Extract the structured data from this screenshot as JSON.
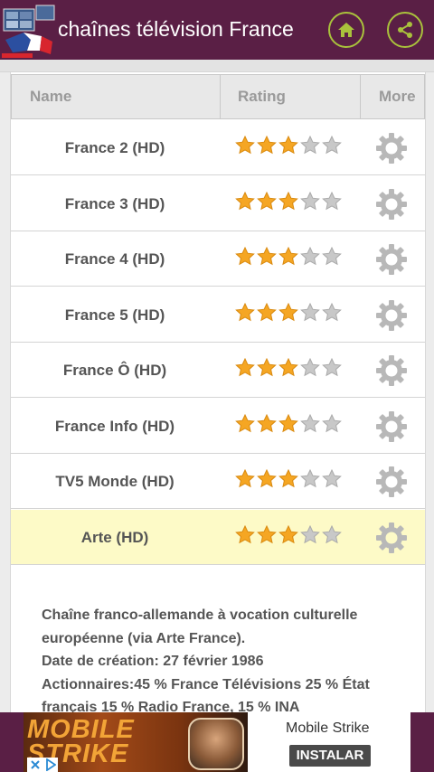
{
  "appbar": {
    "title": "chaînes télévision France",
    "logo_icon": "tv-flag-logo-icon",
    "home_icon": "home-icon",
    "share_icon": "share-icon",
    "accent_color": "#a9c13c",
    "bar_color": "#5a1f45"
  },
  "table": {
    "headers": {
      "name": "Name",
      "rating": "Rating",
      "more": "More"
    },
    "rows": [
      {
        "name": "France 2 (HD)",
        "rating": 3,
        "max_rating": 5,
        "selected": false
      },
      {
        "name": "France 3 (HD)",
        "rating": 3,
        "max_rating": 5,
        "selected": false
      },
      {
        "name": "France 4 (HD)",
        "rating": 3,
        "max_rating": 5,
        "selected": false
      },
      {
        "name": "France 5 (HD)",
        "rating": 3,
        "max_rating": 5,
        "selected": false
      },
      {
        "name": "France Ô (HD)",
        "rating": 3,
        "max_rating": 5,
        "selected": false
      },
      {
        "name": "France Info (HD)",
        "rating": 3,
        "max_rating": 5,
        "selected": false
      },
      {
        "name": "TV5 Monde (HD)",
        "rating": 3,
        "max_rating": 5,
        "selected": false
      },
      {
        "name": "Arte (HD)",
        "rating": 3,
        "max_rating": 5,
        "selected": true
      }
    ],
    "more_icon": "gear-icon",
    "star_filled_color": "#f5a623",
    "star_empty_color": "#c8c8c8",
    "selected_row_color": "#fdfac7"
  },
  "description": {
    "lines": [
      "Chaîne franco-allemande à vocation culturelle",
      "européenne (via Arte France).",
      "Date de création: 27 février 1986",
      "Actionnaires:45 % France Télévisions 25 % État",
      "français 15 % Radio France, 15 % INA"
    ]
  },
  "ad": {
    "image_text": "MOBILE STRIKE",
    "title": "Mobile Strike",
    "install_label": "INSTALAR",
    "info_icon": "ad-info-icon",
    "close_icon": "ad-choices-icon"
  }
}
